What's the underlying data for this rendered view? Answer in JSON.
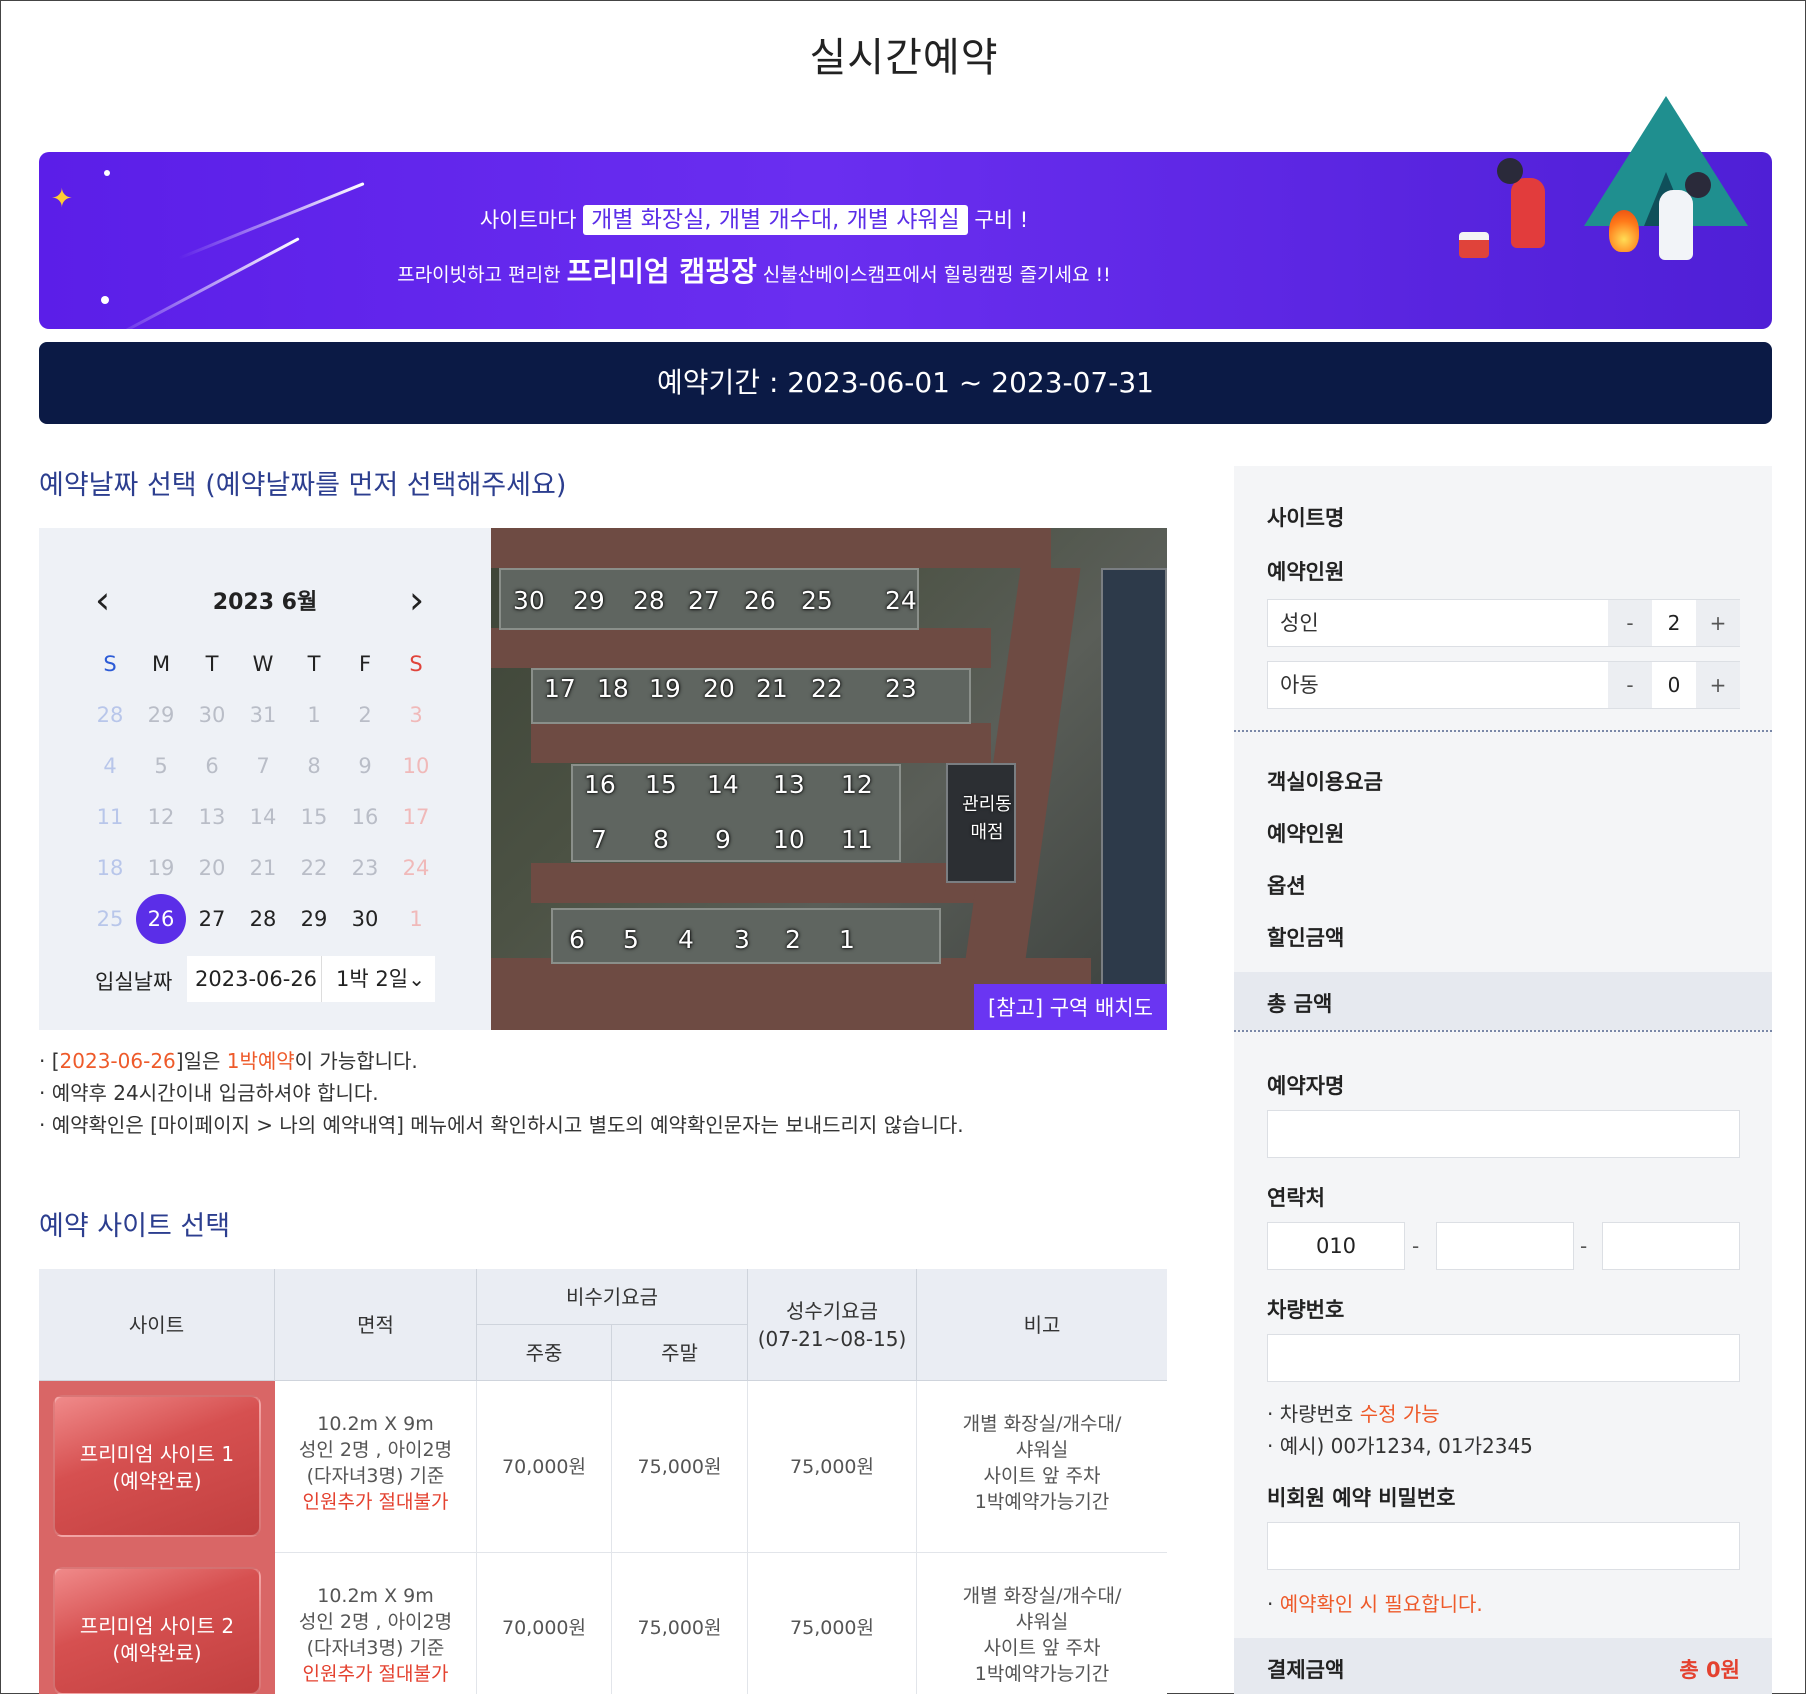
{
  "title": "실시간예약",
  "banner": {
    "line1_pre": "사이트마다",
    "line1_highlight": "개별 화장실, 개별 개수대, 개별 샤워실",
    "line1_post": "구비 !",
    "line2_pre": "프라이빗하고 편리한",
    "line2_big": "프리미엄 캠핑장",
    "line2_post": "신불산베이스캠프에서 힐링캠핑 즐기세요 !!"
  },
  "period_text": "예약기간 : 2023-06-01 ~ 2023-07-31",
  "date_section_title": "예약날짜 선택  (예약날짜를 먼저 선택해주세요)",
  "calendar": {
    "month_label": "2023  6월",
    "weekdays": [
      "S",
      "M",
      "T",
      "W",
      "T",
      "F",
      "S"
    ],
    "weeks": [
      [
        "28",
        "29",
        "30",
        "31",
        "1",
        "2",
        "3"
      ],
      [
        "4",
        "5",
        "6",
        "7",
        "8",
        "9",
        "10"
      ],
      [
        "11",
        "12",
        "13",
        "14",
        "15",
        "16",
        "17"
      ],
      [
        "18",
        "19",
        "20",
        "21",
        "22",
        "23",
        "24"
      ],
      [
        "25",
        "26",
        "27",
        "28",
        "29",
        "30",
        "1"
      ]
    ],
    "selected_day": "26",
    "checkin_label": "입실날짜",
    "checkin_date": "2023-06-26",
    "nights_select": "1박 2일"
  },
  "sitemap": {
    "row_top": [
      "30",
      "29",
      "28",
      "27",
      "26",
      "25",
      "24"
    ],
    "row_second": [
      "17",
      "18",
      "19",
      "20",
      "21",
      "22",
      "23"
    ],
    "row_mid_top": [
      "16",
      "15",
      "14",
      "13",
      "12"
    ],
    "row_mid_bottom": [
      "7",
      "8",
      "9",
      "10",
      "11"
    ],
    "row_bottom": [
      "6",
      "5",
      "4",
      "3",
      "2",
      "1"
    ],
    "office_line1": "관리동",
    "office_line2": "매점",
    "reference_label": "[참고] 구역 배치도"
  },
  "notes": {
    "n1_open": "[",
    "n1_date": "2023-06-26",
    "n1_mid": "]일은 ",
    "n1_stay": "1박예약",
    "n1_end": "이 가능합니다.",
    "n2": "예약후 24시간이내 입금하셔야 합니다.",
    "n3": "예약확인은 [마이페이지 > 나의 예약내역] 메뉴에서 확인하시고 별도의 예약확인문자는 보내드리지 않습니다."
  },
  "site_section_title": "예약 사이트 선택",
  "table": {
    "headers": {
      "site": "사이트",
      "area": "면적",
      "offseason": "비수기요금",
      "weekday": "주중",
      "weekend": "주말",
      "peak_line1": "성수기요금",
      "peak_line2": "(07-21~08-15)",
      "note": "비고"
    },
    "rows": [
      {
        "site_line1": "프리미엄 사이트 1",
        "site_line2": "(예약완료)",
        "area1": "10.2m X 9m",
        "area2": "성인 2명 , 아이2명",
        "area3": "(다자녀3명) 기준",
        "area4": "인원추가 절대불가",
        "weekday": "70,000원",
        "weekend": "75,000원",
        "peak": "75,000원",
        "note1": "개별 화장실/개수대/",
        "note2": "샤워실",
        "note3": "사이트 앞 주차",
        "note4": "1박예약가능기간"
      },
      {
        "site_line1": "프리미엄 사이트 2",
        "site_line2": "(예약완료)",
        "area1": "10.2m X 9m",
        "area2": "성인 2명 , 아이2명",
        "area3": "(다자녀3명) 기준",
        "area4": "인원추가 절대불가",
        "weekday": "70,000원",
        "weekend": "75,000원",
        "peak": "75,000원",
        "note1": "개별 화장실/개수대/",
        "note2": "샤워실",
        "note3": "사이트 앞 주차",
        "note4": "1박예약가능기간"
      }
    ]
  },
  "panel": {
    "site_name_label": "사이트명",
    "people_label": "예약인원",
    "adult_label": "성인",
    "adult_count": "2",
    "child_label": "아동",
    "child_count": "0",
    "minus": "-",
    "plus": "+",
    "room_fee_label": "객실이용요금",
    "people_fee_label": "예약인원",
    "option_label": "옵션",
    "discount_label": "할인금액",
    "total_label": "총 금액",
    "name_label": "예약자명",
    "contact_label": "연락처",
    "phone_prefix": "010",
    "dash": "-",
    "car_label": "차량번호",
    "car_note1_pre": "차량번호 ",
    "car_note1_hl": "수정 가능",
    "car_note2": "예시) 00가1234, 01가2345",
    "pw_label": "비회원 예약 비밀번호",
    "pw_note": "예약확인 시 필요합니다.",
    "payment_label": "결제금액",
    "payment_value": "총 0원"
  }
}
